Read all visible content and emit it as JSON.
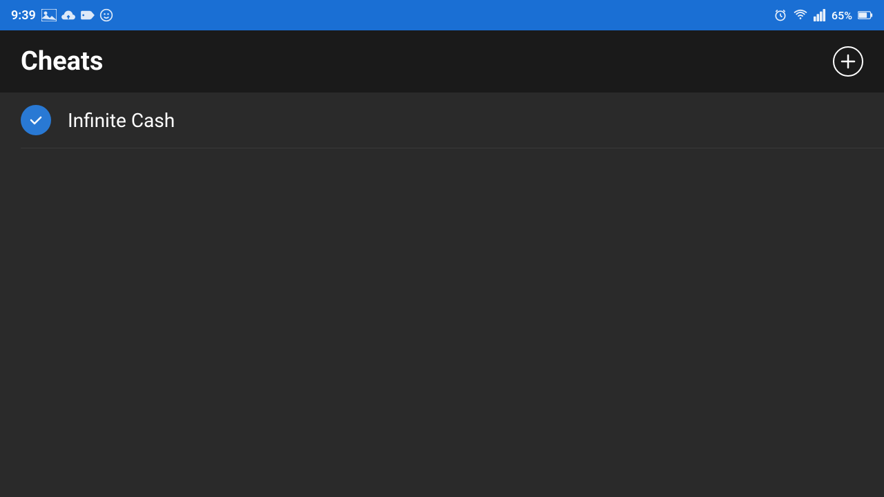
{
  "status_bar": {
    "time": "9:39",
    "battery": "65%",
    "icons": [
      "image-icon",
      "cloud-icon",
      "sd-icon",
      "undo-icon"
    ]
  },
  "header": {
    "title": "Cheats",
    "add_button_label": "+"
  },
  "cheats": [
    {
      "id": 1,
      "label": "Infinite Cash",
      "enabled": true
    }
  ],
  "colors": {
    "status_bar_bg": "#1a6fd4",
    "header_bg": "#1a1a1a",
    "content_bg": "#2a2a2a",
    "check_circle": "#2979d4",
    "divider": "#3a3a3a",
    "text_primary": "#ffffff"
  }
}
